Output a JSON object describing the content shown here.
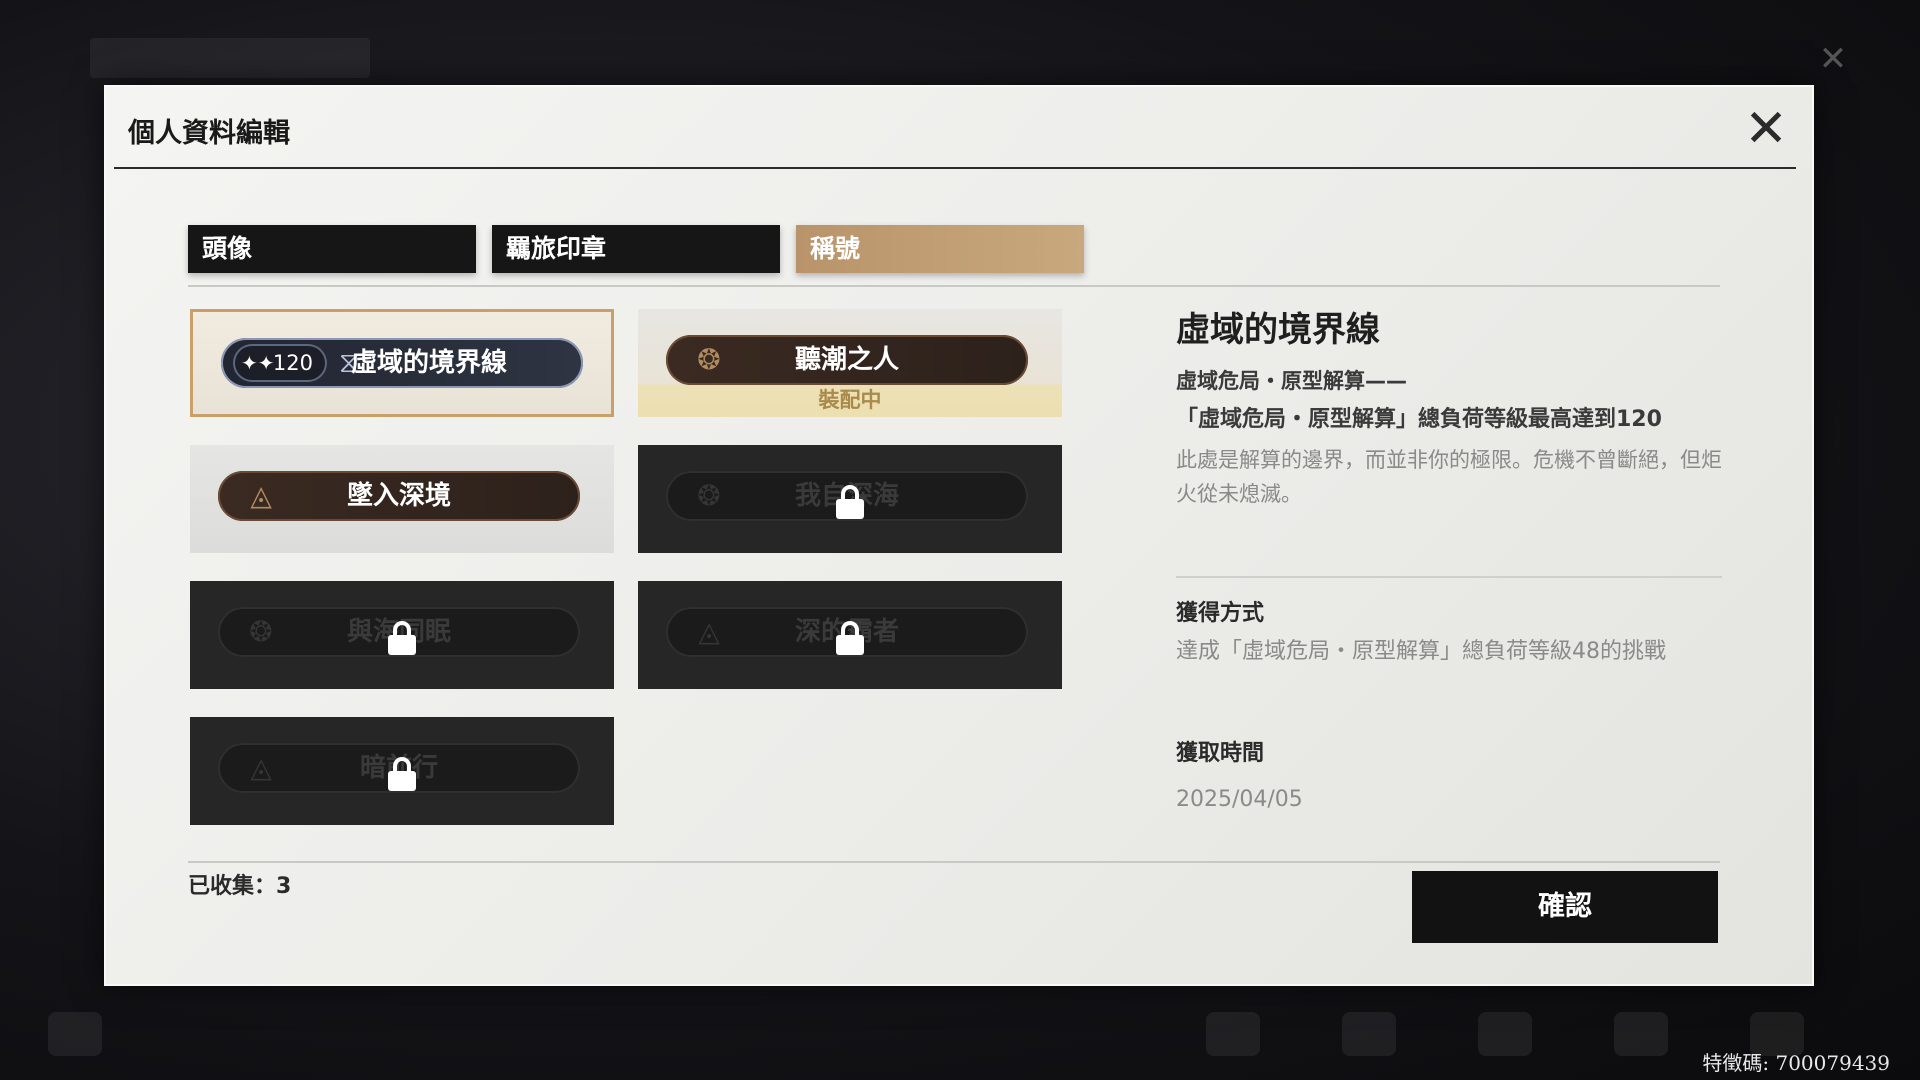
{
  "dialog": {
    "title": "個人資料編輯",
    "close_icon": "close-icon"
  },
  "tabs": [
    {
      "label": "頭像",
      "active": false
    },
    {
      "label": "羈旅印章",
      "active": false
    },
    {
      "label": "稱號",
      "active": true
    }
  ],
  "titles": [
    {
      "name": "虛域的境界線",
      "state": "selected",
      "badge": "120",
      "icon": "hourglass-icon"
    },
    {
      "name": "聽潮之人",
      "state": "equipped",
      "status": "裝配中",
      "icon": "emblem-icon"
    },
    {
      "name": "墜入深境",
      "state": "unlocked",
      "icon": "triangle-icon"
    },
    {
      "name": "我自深海",
      "state": "locked",
      "icon": "emblem-icon"
    },
    {
      "name": "與海同眠",
      "state": "locked",
      "icon": "emblem-icon"
    },
    {
      "name": "深的霸者",
      "state": "locked",
      "icon": "triangle-icon"
    },
    {
      "name": "暗前行",
      "state": "locked",
      "icon": "triangle-icon"
    }
  ],
  "detail": {
    "title": "虛域的境界線",
    "subtitle": "虛域危局・原型解算——",
    "condition": "「虛域危局・原型解算」總負荷等級最高達到120",
    "description": "此處是解算的邊界，而並非你的極限。危機不曾斷絕，但炬火從未熄滅。",
    "obtain_label": "獲得方式",
    "obtain_value": "達成「虛域危局・原型解算」總負荷等級48的挑戰",
    "time_label": "獲取時間",
    "time_value": "2025/04/05"
  },
  "footer": {
    "collected": "已收集：3",
    "confirm_label": "確認"
  },
  "uid": "特徵碼: 700079439",
  "colors": {
    "accent_gold": "#c9a06a",
    "tab_active": "#b9946a",
    "dark": "#161616"
  }
}
